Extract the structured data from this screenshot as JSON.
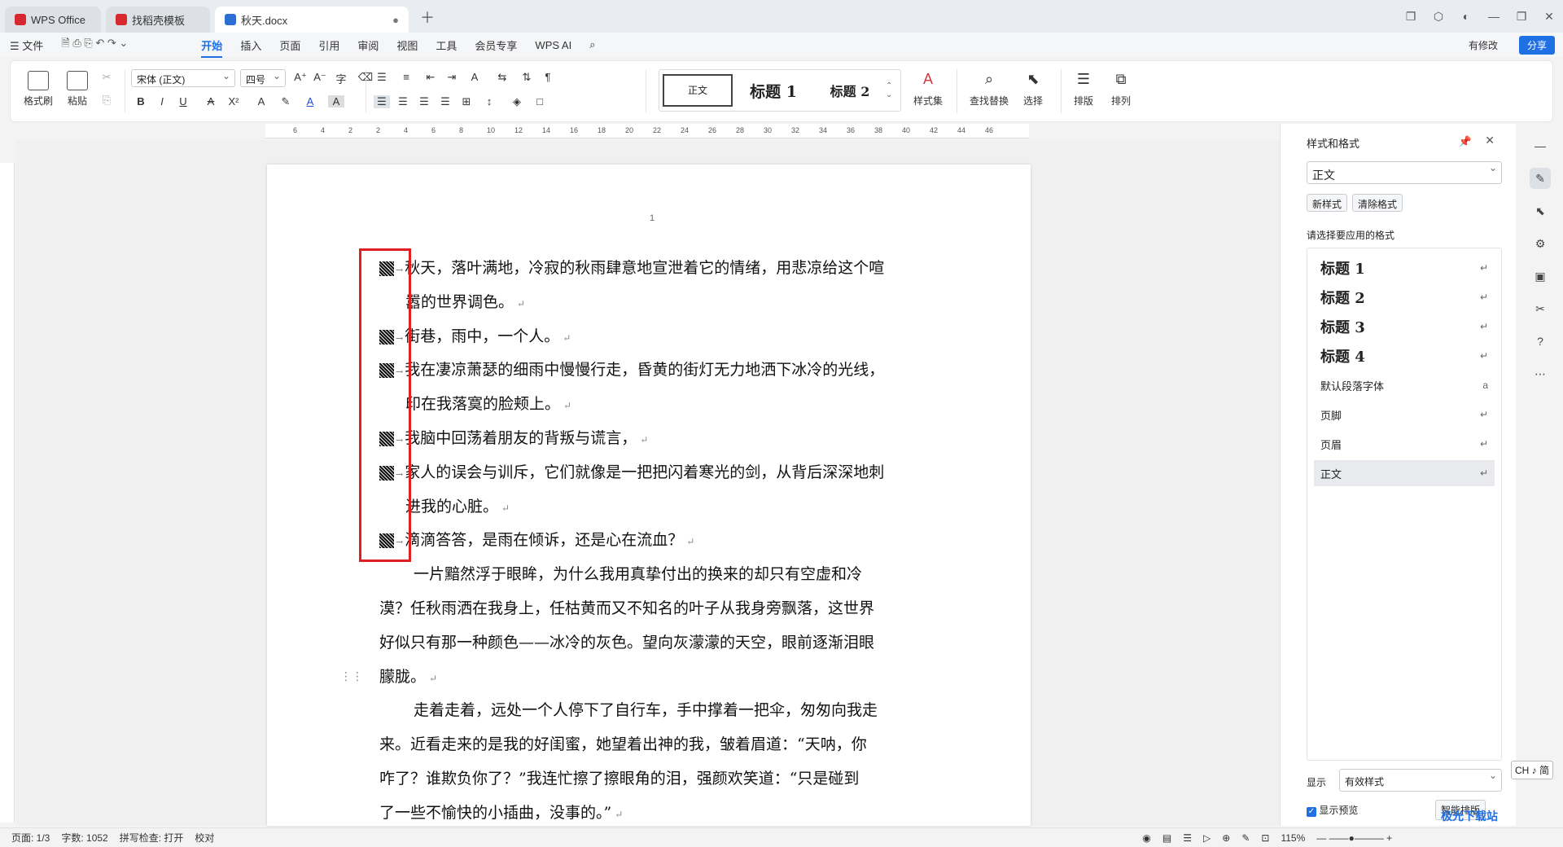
{
  "tabs": [
    {
      "label": "WPS Office",
      "color": "#d7282f"
    },
    {
      "label": "找稻壳模板",
      "color": "#d7282f"
    },
    {
      "label": "秋天.docx",
      "color": "#2b6fd6"
    }
  ],
  "menu": [
    "文件",
    "开始",
    "插入",
    "页面",
    "引用",
    "审阅",
    "视图",
    "工具",
    "会员专享",
    "WPS AI"
  ],
  "menu_right": {
    "modified": "有修改",
    "share": "分享"
  },
  "ribbon": {
    "format_painter": "格式刷",
    "paste": "粘贴",
    "font_name": "宋体 (正文)",
    "font_size": "四号",
    "style_normal": "正文",
    "style_h1": "标题 1",
    "style_h2": "标题 2",
    "style_set": "样式集",
    "find_replace": "查找替换",
    "select": "选择",
    "typeset": "排版",
    "arrange": "排列"
  },
  "ruler_ticks": [
    "6",
    "4",
    "2",
    "2",
    "4",
    "6",
    "8",
    "10",
    "12",
    "14",
    "16",
    "18",
    "20",
    "22",
    "24",
    "26",
    "28",
    "30",
    "32",
    "34",
    "36",
    "38",
    "40",
    "42",
    "44",
    "46"
  ],
  "page_number": "1",
  "doc_lines": [
    {
      "bullet": true,
      "text": "秋天，落叶满地，冷寂的秋雨肆意地宣泄着它的情绪，用悲凉给这个喧"
    },
    {
      "bullet": false,
      "indent": "hang",
      "text": "嚣的世界调色。"
    },
    {
      "bullet": true,
      "text": "街巷，雨中，一个人。"
    },
    {
      "bullet": true,
      "text": "我在凄凉萧瑟的细雨中慢慢行走，昏黄的街灯无力地洒下冰冷的光线，"
    },
    {
      "bullet": false,
      "indent": "hang",
      "text": "印在我落寞的脸颊上。"
    },
    {
      "bullet": true,
      "text": "我脑中回荡着朋友的背叛与谎言，"
    },
    {
      "bullet": true,
      "text": "家人的误会与训斥，它们就像是一把把闪着寒光的剑，从背后深深地刺"
    },
    {
      "bullet": false,
      "indent": "hang",
      "text": "进我的心脏。"
    },
    {
      "bullet": true,
      "text": "滴滴答答，是雨在倾诉，还是心在流血？"
    },
    {
      "bullet": false,
      "indent": "first",
      "text": "一片黯然浮于眼眸，为什么我用真挚付出的换来的却只有空虚和冷"
    },
    {
      "bullet": false,
      "indent": "none",
      "text": "漠？任秋雨洒在我身上，任枯黄而又不知名的叶子从我身旁飘落，这世界"
    },
    {
      "bullet": false,
      "indent": "none",
      "text": "好似只有那一种颜色——冰冷的灰色。望向灰濛濛的天空，眼前逐渐泪眼"
    },
    {
      "bullet": false,
      "indent": "none",
      "text": "朦胧。"
    },
    {
      "bullet": false,
      "indent": "first",
      "text": "走着走着，远处一个人停下了自行车，手中撑着一把伞，匆匆向我走"
    },
    {
      "bullet": false,
      "indent": "none",
      "text": "来。近看走来的是我的好闺蜜，她望着出神的我，皱着眉道：“天呐，你"
    },
    {
      "bullet": false,
      "indent": "none",
      "text": "咋了？谁欺负你了？”我连忙擦了擦眼角的泪，强颜欢笑道：“只是碰到"
    },
    {
      "bullet": false,
      "indent": "none",
      "text": "了一些不愉快的小插曲，没事的。”"
    }
  ],
  "panel": {
    "title": "样式和格式",
    "current": "正文",
    "new_style": "新样式",
    "clear_format": "清除格式",
    "hint": "请选择要应用的格式",
    "styles": [
      {
        "name": "标题 1",
        "big": true
      },
      {
        "name": "标题 2",
        "big": true
      },
      {
        "name": "标题 3",
        "big": true
      },
      {
        "name": "标题 4",
        "big": true
      },
      {
        "name": "默认段落字体",
        "big": false
      },
      {
        "name": "页脚",
        "big": false
      },
      {
        "name": "页眉",
        "big": false
      },
      {
        "name": "正文",
        "big": false
      }
    ],
    "show_label": "显示",
    "show_value": "有效样式",
    "preview": "显示预览",
    "smart": "智能排版"
  },
  "ime": "CH ♪ 简",
  "status": {
    "page": "页面: 1/3",
    "words": "字数: 1052",
    "spell": "拼写检查: 打开",
    "proof": "校对",
    "zoom": "115%"
  },
  "watermark": "极光下载站"
}
